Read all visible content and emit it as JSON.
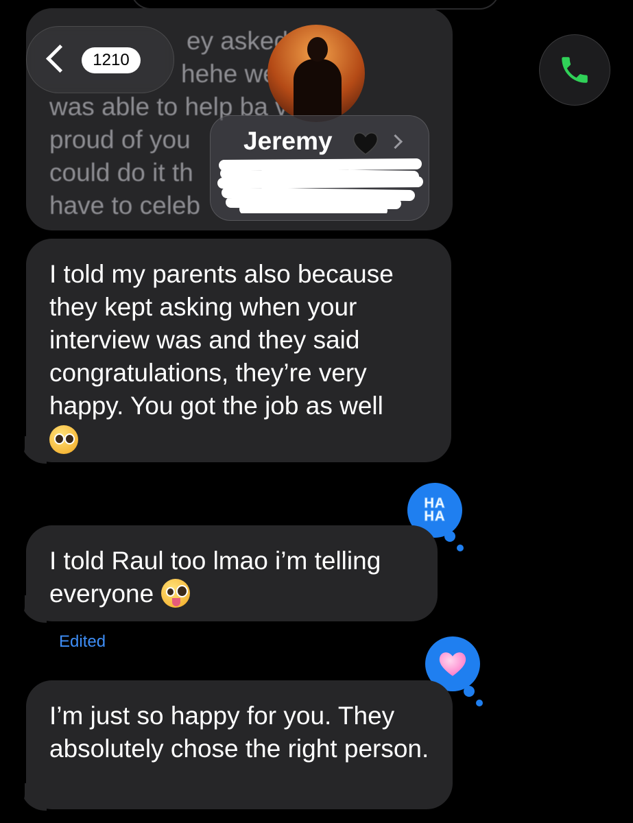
{
  "header": {
    "back_count": "1210",
    "contact_name": "Jeremy",
    "name_emoji": "black-heart-icon"
  },
  "messages": [
    {
      "id": "msg-1",
      "direction": "incoming",
      "obscured": true,
      "lines": [
        "ey asked    f my",
        "hehe we      e I",
        "was able to help ba        very",
        "proud of you",
        "could do it th",
        "have to celeb"
      ]
    },
    {
      "id": "msg-2",
      "direction": "incoming",
      "text": "I told my parents also because they kept asking when your interview was and they said congratulations, they’re very happy. You got the job as well",
      "emoji": "pleading-face"
    },
    {
      "id": "msg-3",
      "direction": "incoming",
      "text": "I told Raul too lmao i’m telling everyone",
      "emoji": "zany-face",
      "tapback": "HA HA",
      "status": "Edited"
    },
    {
      "id": "msg-4",
      "direction": "incoming",
      "text": "I’m just so happy for you. They absolutely chose the right person.",
      "tapback": "heart-icon"
    }
  ],
  "colors": {
    "background": "#000000",
    "incoming_bubble": "#262628",
    "tapback_blue": "#1f7ff0",
    "edited_blue": "#3e8ef7",
    "call_green": "#30d158"
  }
}
